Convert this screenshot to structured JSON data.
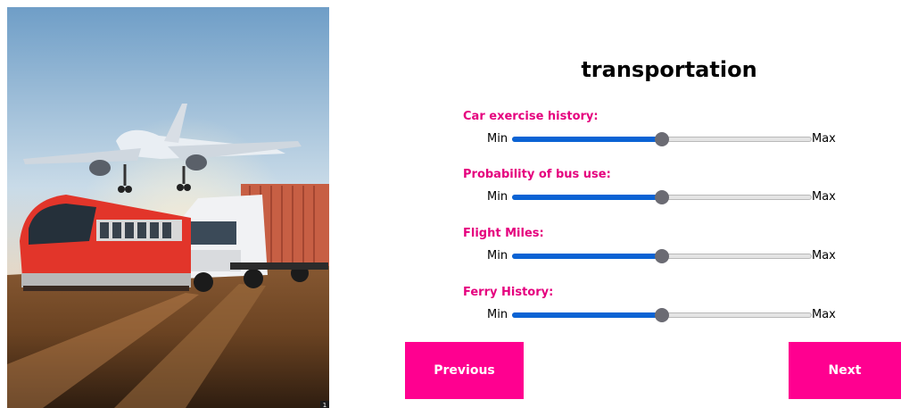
{
  "hero": {
    "icon": "transportation-illustration",
    "corner_badge": "1"
  },
  "form": {
    "title": "transportation",
    "sliders": [
      {
        "label": "Car exercise history:",
        "min_label": "Min",
        "max_label": "Max",
        "value": 50
      },
      {
        "label": "Probability of bus use:",
        "min_label": "Min",
        "max_label": "Max",
        "value": 50
      },
      {
        "label": "Flight Miles:",
        "min_label": "Min",
        "max_label": "Max",
        "value": 50
      },
      {
        "label": "Ferry History:",
        "min_label": "Min",
        "max_label": "Max",
        "value": 50
      }
    ],
    "previous_label": "Previous",
    "next_label": "Next"
  },
  "colors": {
    "accent": "#ff0090",
    "label": "#e5007e",
    "slider_fill": "#0b63d4",
    "slider_thumb": "#6b6b73"
  }
}
